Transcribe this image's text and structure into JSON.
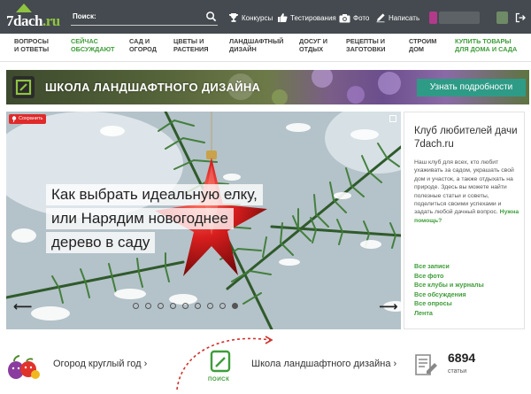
{
  "header": {
    "logo": {
      "main": "7dach",
      "suffix": ".ru"
    },
    "search": {
      "label": "Поиск:",
      "value": "",
      "placeholder": ""
    },
    "links": [
      {
        "label": "Конкурсы",
        "icon": "trophy-icon"
      },
      {
        "label": "Тестирования",
        "icon": "thumbs-up-icon"
      },
      {
        "label": "Фото",
        "icon": "camera-icon"
      },
      {
        "label": "Написать",
        "icon": "pencil-icon"
      }
    ],
    "icons": {
      "search": "search-icon",
      "logout": "logout-icon"
    }
  },
  "nav": {
    "items": [
      {
        "line1": "Вопросы",
        "line2": "и ответы"
      },
      {
        "line1": "Сейчас",
        "line2": "обсуждают"
      },
      {
        "line1": "Сад и",
        "line2": "огород"
      },
      {
        "line1": "Цветы и",
        "line2": "растения"
      },
      {
        "line1": "Ландшафтный",
        "line2": "дизайн"
      },
      {
        "line1": "Досуг и",
        "line2": "отдых"
      },
      {
        "line1": "Рецепты и",
        "line2": "заготовки"
      },
      {
        "line1": "Строим",
        "line2": "дом"
      },
      {
        "line1": "Купить товары",
        "line2": "для дома и сада"
      }
    ],
    "accent_color": "#3f9d3a"
  },
  "banner": {
    "title": "ШКОЛА ЛАНДШАФТНОГО ДИЗАЙНА",
    "button": "Узнать подробности",
    "button_color": "#2e9b87"
  },
  "hero": {
    "save_label": "Сохранить",
    "caption": [
      "Как выбрать идеальную елку,",
      "или Нарядим новогоднее",
      "дерево в саду"
    ],
    "dots": {
      "count": 9,
      "active_index": 8
    }
  },
  "info": {
    "title_line1": "Клуб любителей дачи",
    "title_line2": "7dach.ru",
    "desc": "Наш клуб для всех, кто любит ухаживать за садом, украшать свой дом и участок, а также отдыхать на природе. Здесь вы можете найти полезные статьи и советы, поделиться своими успехами и задать любой дачный вопрос. ",
    "help_link": "Нужна помощь?",
    "links": [
      "Все записи",
      "Все фото",
      "Все клубы и журналы",
      "Все обсуждения",
      "Все опросы",
      "Лента"
    ]
  },
  "bottom": {
    "garden_link": "Огород круглый год ›",
    "poisk_label": "ПОИСК",
    "school_link": "Школа ландшафтного дизайна ›",
    "count": "6894",
    "count_label": "статьи",
    "icons": {
      "fruit": "fruit-vegetables-icon",
      "poisk": "poisk-logo-icon",
      "articles": "articles-icon"
    }
  }
}
